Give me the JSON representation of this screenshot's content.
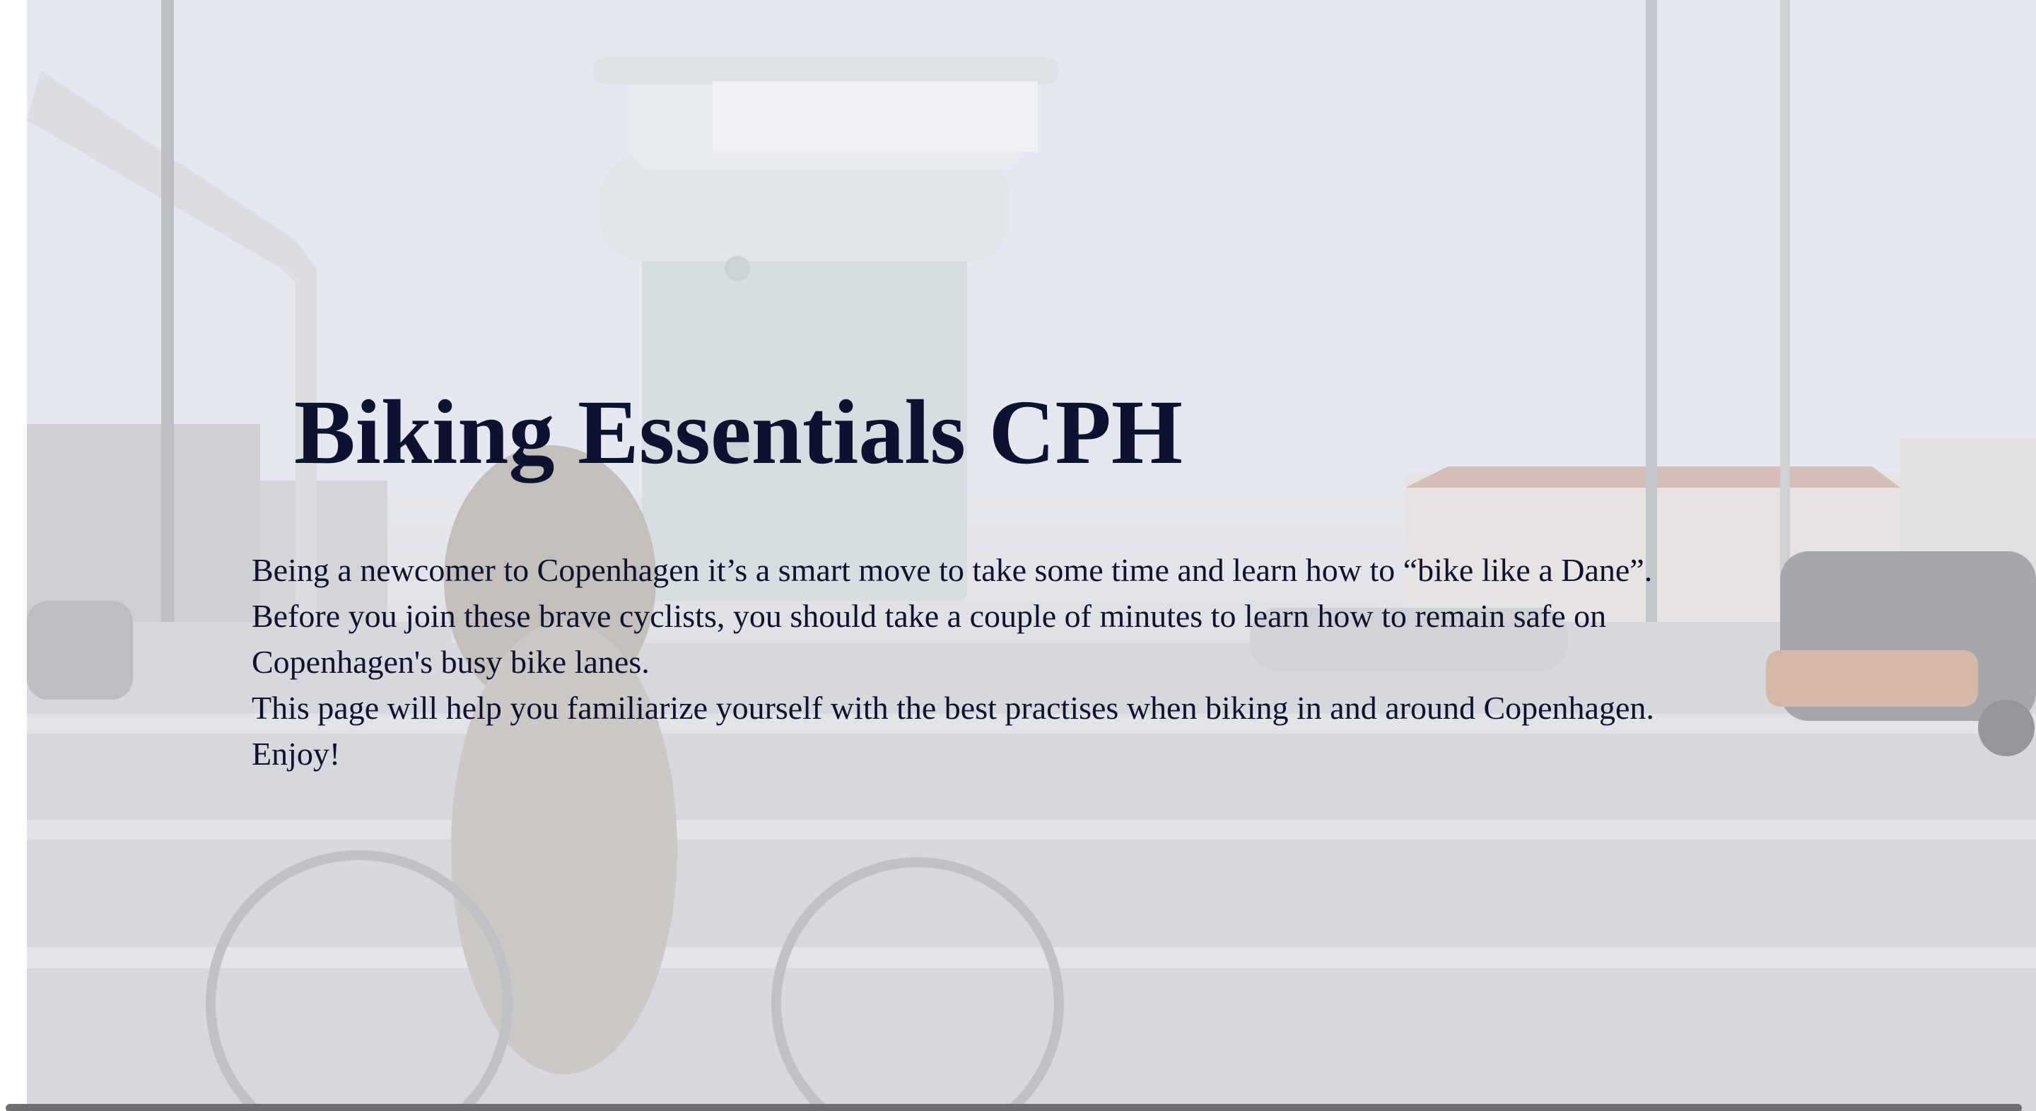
{
  "hero": {
    "background_image": "blurred-cyclist-copenhagen-bridge-tower-photo",
    "title": "Biking Essentials CPH",
    "paragraphs": [
      "Being a newcomer to Copenhagen it’s a smart move to take some time and learn how to “bike like a Dane”.",
      "Before you join these brave cyclists, you should take a couple of minutes to learn how to remain safe on Copenhagen's busy bike lanes.",
      "This page will help you familiarize yourself with the best practises when biking in and around Copenhagen.",
      "Enjoy!"
    ]
  },
  "colors": {
    "text": "#0c1230",
    "overlay": "#e8ebf2",
    "scrollbar": "#6f6f73"
  }
}
